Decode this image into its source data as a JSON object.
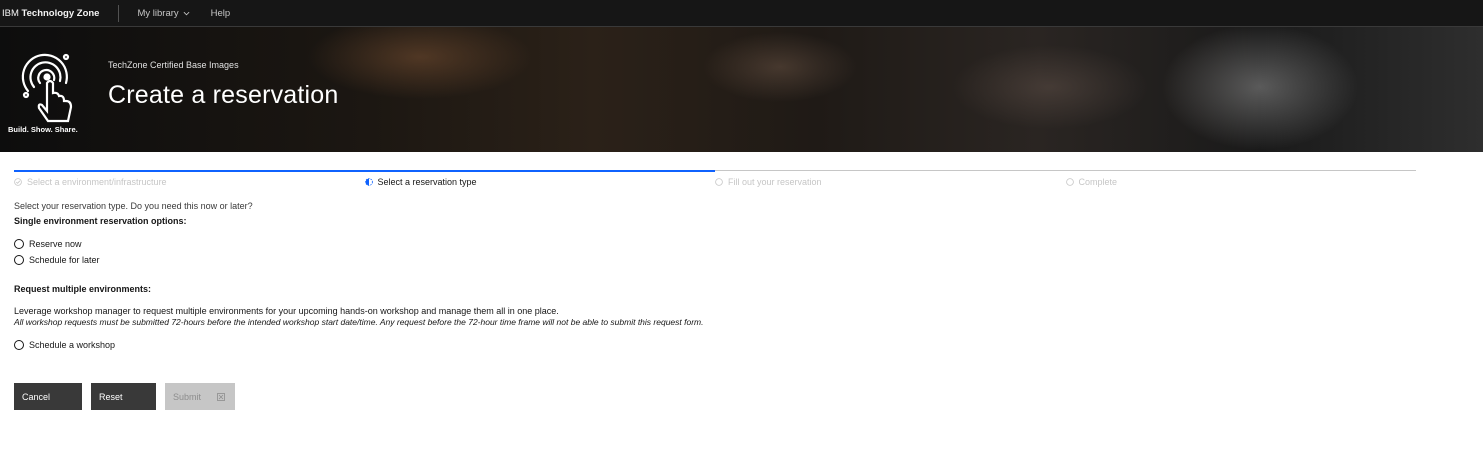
{
  "topnav": {
    "brand_prefix": "IBM",
    "brand_name": "Technology Zone",
    "my_library": "My library",
    "help": "Help"
  },
  "hero": {
    "tagline": "Build. Show. Share.",
    "subtitle": "TechZone Certified Base Images",
    "title": "Create a reservation"
  },
  "progress": {
    "steps": [
      {
        "label": "Select a environment/infrastructure",
        "state": "complete"
      },
      {
        "label": "Select a reservation type",
        "state": "current"
      },
      {
        "label": "Fill out your reservation",
        "state": "incomplete"
      },
      {
        "label": "Complete",
        "state": "incomplete"
      }
    ],
    "accent_color": "#0f62fe"
  },
  "form": {
    "intro": "Select your reservation type. Do you need this now or later?",
    "single_heading": "Single environment reservation options:",
    "single_options": [
      "Reserve now",
      "Schedule for later"
    ],
    "multiple_heading": "Request multiple environments:",
    "multiple_description": "Leverage workshop manager to request multiple environments for your upcoming hands-on workshop and manage them all in one place.",
    "multiple_note": "All workshop requests must be submitted 72-hours before the intended workshop start date/time. Any request before the 72-hour time frame will not be able to submit this request form.",
    "multiple_options": [
      "Schedule a workshop"
    ]
  },
  "actions": {
    "cancel": "Cancel",
    "reset": "Reset",
    "submit": "Submit",
    "submit_icon": "close-box-icon"
  }
}
